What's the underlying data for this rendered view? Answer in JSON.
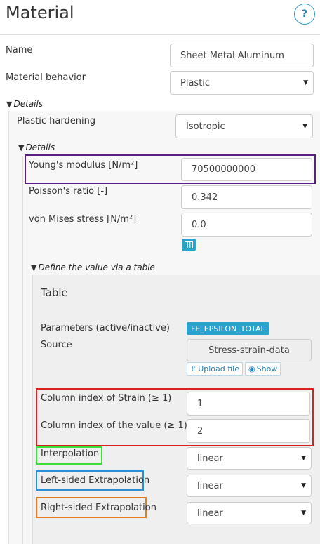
{
  "header": {
    "title": "Material",
    "help_label": "?"
  },
  "name": {
    "label": "Name",
    "value": "Sheet Metal Aluminum"
  },
  "material_behavior": {
    "label": "Material behavior",
    "value": "Plastic"
  },
  "details1": {
    "label": "Details"
  },
  "plastic_hardening": {
    "label": "Plastic hardening",
    "value": "Isotropic"
  },
  "details2": {
    "label": "Details"
  },
  "youngs_modulus": {
    "label": "Young's modulus [N/m²]",
    "value": "70500000000"
  },
  "poissons_ratio": {
    "label": "Poisson's ratio [-]",
    "value": "0.342"
  },
  "von_mises": {
    "label": "von Mises stress [N/m²]",
    "value": "0.0",
    "table_icon": "table-icon"
  },
  "define_table": {
    "label": "Define the value via a table"
  },
  "table": {
    "title": "Table",
    "parameters_label": "Parameters (active/inactive)",
    "parameter_badge": "FE_EPSILON_TOTAL",
    "source_label": "Source",
    "source_value": "Stress-strain-data",
    "upload_label": "Upload file",
    "show_label": "Show",
    "col_strain_label": "Column index of Strain (≥ 1)",
    "col_strain_value": "1",
    "col_value_label": "Column index of the value (≥ 1)",
    "col_value_value": "2",
    "interpolation_label": "Interpolation",
    "interpolation_value": "linear",
    "left_extrap_label": "Left-sided Extrapolation",
    "left_extrap_value": "linear",
    "right_extrap_label": "Right-sided Extrapolation",
    "right_extrap_value": "linear"
  },
  "colors": {
    "purple_highlight": "#5b1f83",
    "red_highlight": "#d9221f",
    "green_highlight": "#3de03a",
    "blue_highlight": "#2b8fd6",
    "orange_highlight": "#e57b1f",
    "accent": "#2aa3cf"
  }
}
